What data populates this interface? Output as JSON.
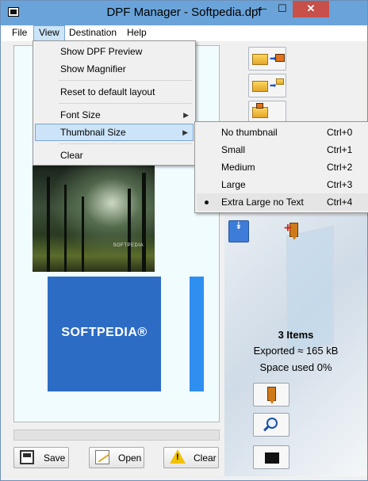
{
  "window": {
    "title": "DPF Manager - Softpedia.dpf",
    "minimize_glyph": "—",
    "maximize_glyph": "☐",
    "close_glyph": "✕"
  },
  "menubar": {
    "file": "File",
    "view": "View",
    "destination": "Destination",
    "help": "Help"
  },
  "view_menu": {
    "items": [
      {
        "label": "Show DPF Preview"
      },
      {
        "label": "Show Magnifier"
      },
      {
        "label": "Reset to default layout"
      },
      {
        "label": "Font Size",
        "submenu": true
      },
      {
        "label": "Thumbnail Size",
        "submenu": true,
        "highlighted": true
      },
      {
        "label": "Clear"
      }
    ],
    "submenu_glyph": "▶"
  },
  "thumbnail_size_menu": {
    "items": [
      {
        "label": "No thumbnail",
        "shortcut": "Ctrl+0"
      },
      {
        "label": "Small",
        "shortcut": "Ctrl+1"
      },
      {
        "label": "Medium",
        "shortcut": "Ctrl+2"
      },
      {
        "label": "Large",
        "shortcut": "Ctrl+3"
      },
      {
        "label": "Extra Large no Text",
        "shortcut": "Ctrl+4",
        "checked": true
      }
    ]
  },
  "preview": {
    "photo_caption": "SOFTPEDIA",
    "thumb_text": "SOFTPEDIA®"
  },
  "stats": {
    "items": "3  Items",
    "exported": "Exported ≈ 165 kB",
    "space_used": "Space used 0%"
  },
  "actions": {
    "save": "Save",
    "open": "Open",
    "clear": "Clear"
  },
  "icons": {
    "down": "⯯",
    "clear_mark": "!"
  },
  "colors": {
    "titlebar": "#6aa3d9",
    "close": "#c7504a",
    "highlight": "#cce4f7",
    "thumb_blue": "#2d6cc4"
  }
}
